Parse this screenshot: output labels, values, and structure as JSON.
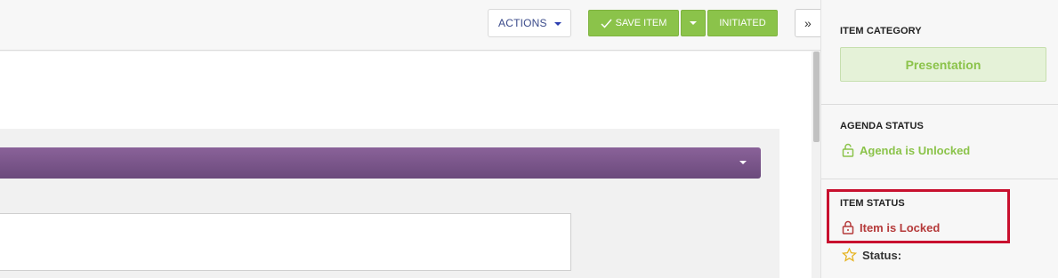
{
  "toolbar": {
    "actions_label": "ACTIONS",
    "save_label": "SAVE ITEM",
    "initiated_label": "INITIATED",
    "expand_label": "»"
  },
  "sidebar": {
    "item_category": {
      "title": "ITEM CATEGORY",
      "value": "Presentation"
    },
    "agenda_status": {
      "title": "AGENDA STATUS",
      "value": "Agenda is Unlocked"
    },
    "item_status": {
      "title": "ITEM STATUS",
      "value": "Item is Locked"
    },
    "status_label": "Status:"
  },
  "colors": {
    "accent_green": "#8bc34a",
    "accent_purple": "#7a5589",
    "locked_red": "#b53a3a",
    "highlight_red": "#c8102e"
  },
  "icons": {
    "save": "check-icon",
    "agenda_lock": "unlock-icon",
    "item_lock": "lock-icon",
    "status": "star-icon"
  }
}
